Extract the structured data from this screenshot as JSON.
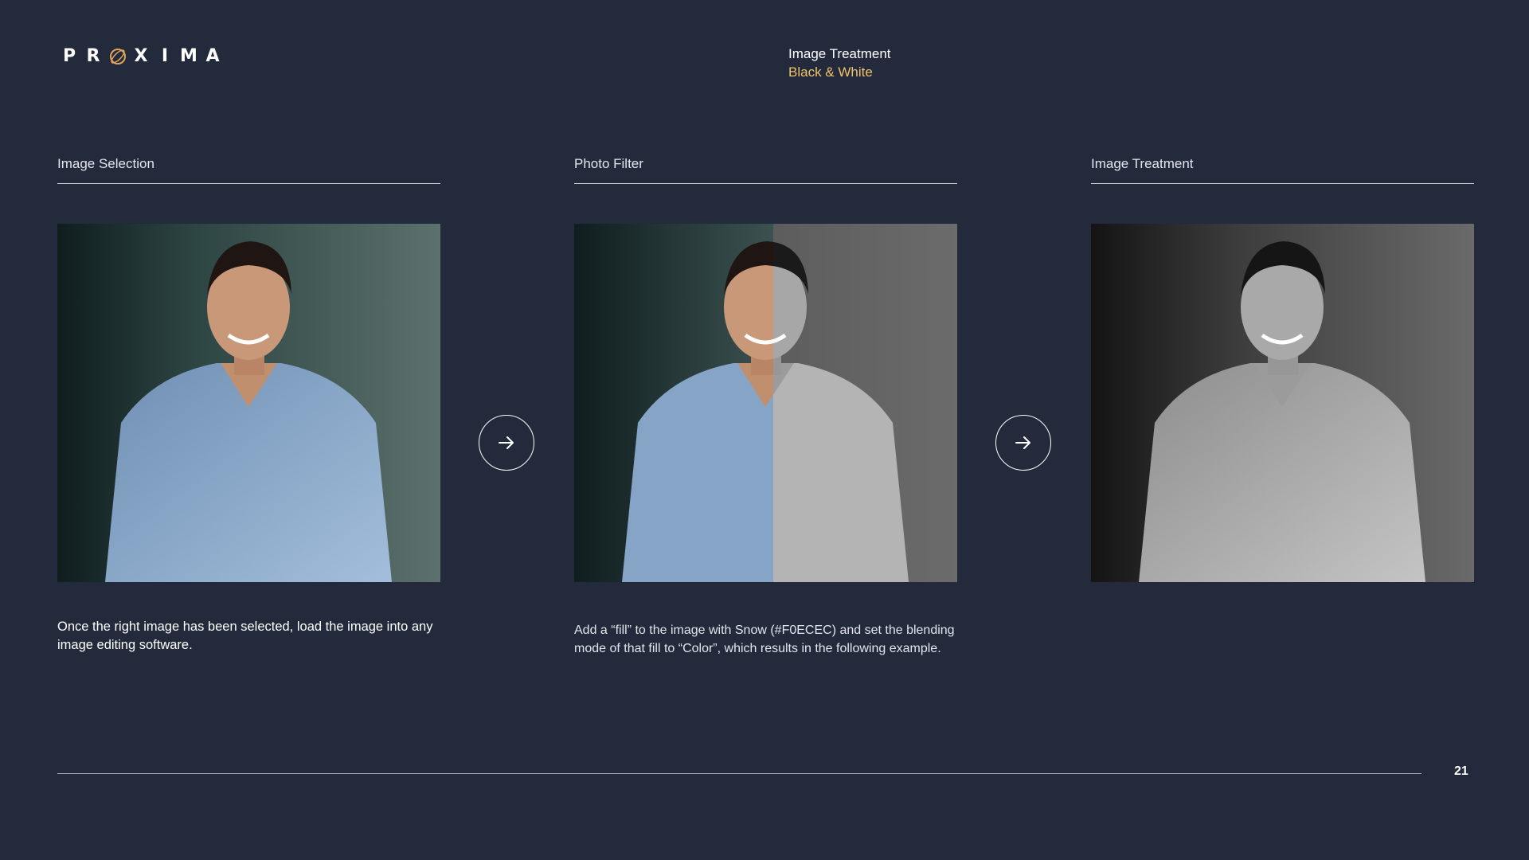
{
  "logo": {
    "letters": [
      "P",
      "R",
      "O",
      "X",
      "I",
      "M",
      "A"
    ],
    "brand_name": "PROXIMA",
    "accent_color": "#e2a45c"
  },
  "header": {
    "title": "Image Treatment",
    "subtitle": "Black & White",
    "subtitle_color": "#f2c26b"
  },
  "columns": [
    {
      "label": "Image Selection",
      "image": "color-portrait-smiling-man",
      "caption": "Once the right image has been selected, load the image into any image editing software."
    },
    {
      "label": "Photo Filter",
      "image": "split-color-and-grayscale-portrait",
      "caption": "Add a “fill” to the image with Snow (#F0ECEC) and set the blending mode of that fill to “Color”, which results in the following example."
    },
    {
      "label": "Image Treatment",
      "image": "grayscale-portrait-smiling-man",
      "caption": ""
    }
  ],
  "arrows": [
    {
      "icon": "arrow-right-icon"
    },
    {
      "icon": "arrow-right-icon"
    }
  ],
  "footer": {
    "page_number": "21"
  },
  "colors": {
    "background": "#222a3b",
    "rule": "#c9ccd3"
  }
}
